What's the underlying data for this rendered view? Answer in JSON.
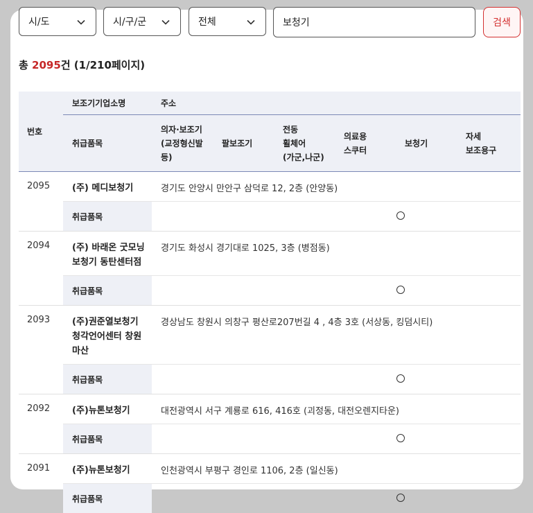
{
  "filters": {
    "sido": "시/도",
    "sigungu": "시/구/군",
    "category": "전체",
    "search_value": "보청기",
    "search_button": "검색"
  },
  "summary": {
    "prefix": "총 ",
    "count": "2095",
    "suffix": "건 (1/210페이지)"
  },
  "table": {
    "headers": {
      "no": "번호",
      "company": "보조기기업소명",
      "address": "주소",
      "items": "취급품목",
      "cols": [
        "의자·보조기\n(교정형신발\n등)",
        "팔보조기",
        "전동\n휠체어\n(가군,나군)",
        "의료용\n스쿠터",
        "보청기",
        "자세\n보조용구"
      ]
    },
    "sub_label": "취급품목",
    "rows": [
      {
        "no": "2095",
        "name": "(주) 메디보청기",
        "address": "경기도 안양시 만안구 삼덕로 12, 2층 (안양동)",
        "marks": [
          false,
          false,
          false,
          false,
          true,
          false
        ]
      },
      {
        "no": "2094",
        "name": "(주) 바래온 굿모닝\n보청기 동탄센터점",
        "address": "경기도 화성시 경기대로 1025, 3층 (병점동)",
        "marks": [
          false,
          false,
          false,
          false,
          true,
          false
        ]
      },
      {
        "no": "2093",
        "name": "(주)권준열보청기\n청각언어센터 창원\n마산",
        "address": "경상남도 창원시 의창구 평산로207번길 4 , 4층 3호 (서상동, 킹덤시티)",
        "marks": [
          false,
          false,
          false,
          false,
          true,
          false
        ]
      },
      {
        "no": "2092",
        "name": "(주)뉴톤보청기",
        "address": "대전광역시 서구 계룡로 616, 416호 (괴정동, 대전오렌지타운)",
        "marks": [
          false,
          false,
          false,
          false,
          true,
          false
        ]
      },
      {
        "no": "2091",
        "name": "(주)뉴톤보청기",
        "address": "인천광역시 부평구 경인로 1106, 2층 (일신동)",
        "marks": [
          false,
          false,
          false,
          false,
          true,
          false
        ]
      }
    ]
  },
  "colors": {
    "accent": "#c62828",
    "header_bg": "#eef0f6",
    "divider": "#7b88b5"
  }
}
